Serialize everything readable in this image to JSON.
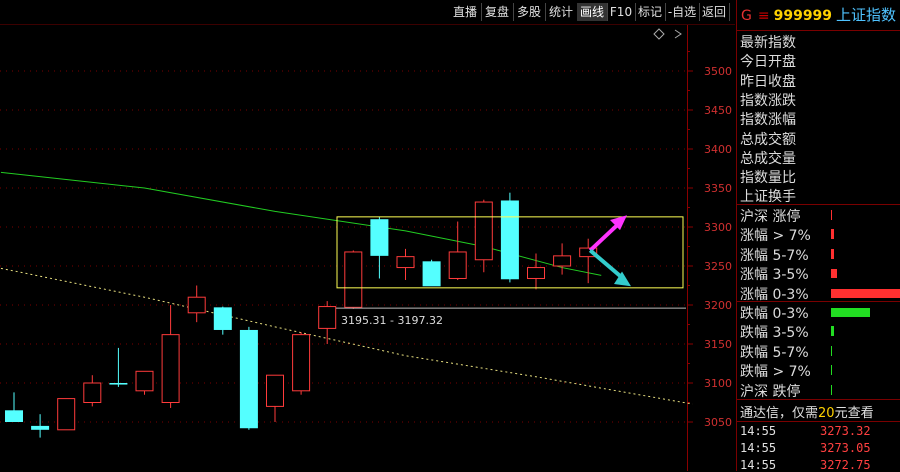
{
  "toolbar": {
    "buttons": [
      "直播",
      "复盘",
      "多股",
      "统计",
      "画线",
      "F10",
      "标记",
      "-自选",
      "返回"
    ],
    "active": "画线"
  },
  "header": {
    "market_letter": "G",
    "menu_glyph": "≡",
    "code": "999999",
    "name": "上证指数"
  },
  "fields": [
    "最新指数",
    "今日开盘",
    "昨日收盘",
    "指数涨跌",
    "指数涨幅",
    "总成交额",
    "总成交量",
    "指数量比",
    "上证换手"
  ],
  "stats_up": [
    {
      "label": "沪深 涨停",
      "level": 0.0
    },
    {
      "label": "涨幅 > 7%",
      "level": 0.01
    },
    {
      "label": "涨幅 5-7%",
      "level": 0.02
    },
    {
      "label": "涨幅 3-5%",
      "level": 0.08
    },
    {
      "label": "涨幅 0-3%",
      "level": 1.0
    }
  ],
  "stats_down": [
    {
      "label": "跌幅 0-3%",
      "level": 0.55
    },
    {
      "label": "跌幅 3-5%",
      "level": 0.03
    },
    {
      "label": "跌幅 5-7%",
      "level": 0.01
    },
    {
      "label": "跌幅 > 7%",
      "level": 0.005
    },
    {
      "label": "沪深 跌停",
      "level": 0.0
    }
  ],
  "notice": {
    "prefix": "通达信，仅需",
    "highlight": "20",
    "suffix": "元查看"
  },
  "trades": [
    {
      "time": "14:55",
      "price": "3273.32"
    },
    {
      "time": "14:55",
      "price": "3273.05"
    },
    {
      "time": "14:55",
      "price": "3272.75"
    }
  ],
  "colors": {
    "up": "#ff3b3b",
    "down": "#54ffff",
    "ma": "#22cc22",
    "box": "#ffff55",
    "arrow_up": "#ff33ff",
    "arrow_down": "#33cccc",
    "bar_up": "#ff3030",
    "bar_down": "#22dd22"
  },
  "chart_data": {
    "type": "candlestick",
    "y_ticks": [
      3500,
      3450,
      3400,
      3350,
      3300,
      3250,
      3200,
      3150,
      3100,
      3050
    ],
    "ylim": [
      3040,
      3550
    ],
    "range_label": "3195.31 - 3197.32",
    "candles": [
      {
        "o": 3065,
        "h": 3088,
        "l": 3050,
        "c": 3050
      },
      {
        "o": 3045,
        "h": 3060,
        "l": 3030,
        "c": 3040
      },
      {
        "o": 3040,
        "h": 3080,
        "l": 3040,
        "c": 3080
      },
      {
        "o": 3075,
        "h": 3110,
        "l": 3070,
        "c": 3100
      },
      {
        "o": 3100,
        "h": 3145,
        "l": 3095,
        "c": 3098
      },
      {
        "o": 3090,
        "h": 3115,
        "l": 3085,
        "c": 3115
      },
      {
        "o": 3075,
        "h": 3200,
        "l": 3068,
        "c": 3162
      },
      {
        "o": 3190,
        "h": 3225,
        "l": 3178,
        "c": 3210
      },
      {
        "o": 3197,
        "h": 3198,
        "l": 3162,
        "c": 3168
      },
      {
        "o": 3168,
        "h": 3172,
        "l": 3040,
        "c": 3042
      },
      {
        "o": 3070,
        "h": 3092,
        "l": 3050,
        "c": 3110
      },
      {
        "o": 3090,
        "h": 3165,
        "l": 3085,
        "c": 3162
      },
      {
        "o": 3170,
        "h": 3205,
        "l": 3150,
        "c": 3198
      },
      {
        "o": 3197,
        "h": 3270,
        "l": 3195,
        "c": 3268
      },
      {
        "o": 3310,
        "h": 3313,
        "l": 3234,
        "c": 3263
      },
      {
        "o": 3248,
        "h": 3272,
        "l": 3232,
        "c": 3262
      },
      {
        "o": 3256,
        "h": 3258,
        "l": 3225,
        "c": 3224
      },
      {
        "o": 3234,
        "h": 3307,
        "l": 3232,
        "c": 3268
      },
      {
        "o": 3258,
        "h": 3335,
        "l": 3242,
        "c": 3332
      },
      {
        "o": 3334,
        "h": 3344,
        "l": 3229,
        "c": 3233
      },
      {
        "o": 3234,
        "h": 3266,
        "l": 3220,
        "c": 3248
      },
      {
        "o": 3250,
        "h": 3279,
        "l": 3239,
        "c": 3263
      },
      {
        "o": 3262,
        "h": 3285,
        "l": 3228,
        "c": 3273
      }
    ],
    "ma_line": [
      [
        -0.5,
        3370
      ],
      [
        5,
        3350
      ],
      [
        10,
        3320
      ],
      [
        15,
        3295
      ],
      [
        18,
        3275
      ],
      [
        21,
        3248
      ],
      [
        22.5,
        3238
      ]
    ],
    "trend_line": [
      [
        -0.5,
        3247
      ],
      [
        5,
        3210
      ],
      [
        10,
        3172
      ],
      [
        15,
        3135
      ],
      [
        20,
        3108
      ],
      [
        26,
        3073
      ]
    ]
  }
}
